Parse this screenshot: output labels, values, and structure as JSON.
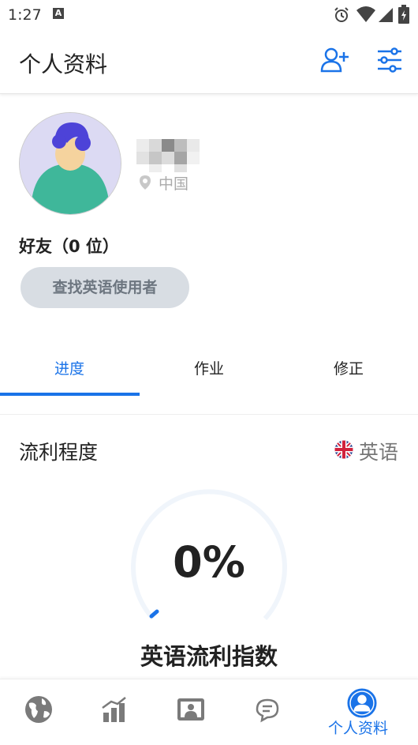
{
  "status_bar": {
    "time": "1:27",
    "notif_letter": "A"
  },
  "header": {
    "title": "个人资料"
  },
  "profile": {
    "location": "中国"
  },
  "friends": {
    "label": "好友（0 位）",
    "find_button": "查找英语使用者"
  },
  "tabs": [
    {
      "label": "进度",
      "active": true
    },
    {
      "label": "作业",
      "active": false
    },
    {
      "label": "修正",
      "active": false
    }
  ],
  "fluency": {
    "label": "流利程度",
    "language": "英语",
    "percent_text": "0%",
    "percent_value": 0,
    "index_label": "英语流利指数"
  },
  "bottom_nav": {
    "active_label": "个人资料",
    "items": [
      "globe-icon",
      "stats-icon",
      "profile-card-icon",
      "chat-icon",
      "profile-icon"
    ]
  },
  "colors": {
    "accent": "#1a73e8",
    "avatar_bg": "#dcdaf3",
    "button_bg": "#d8dde3"
  }
}
